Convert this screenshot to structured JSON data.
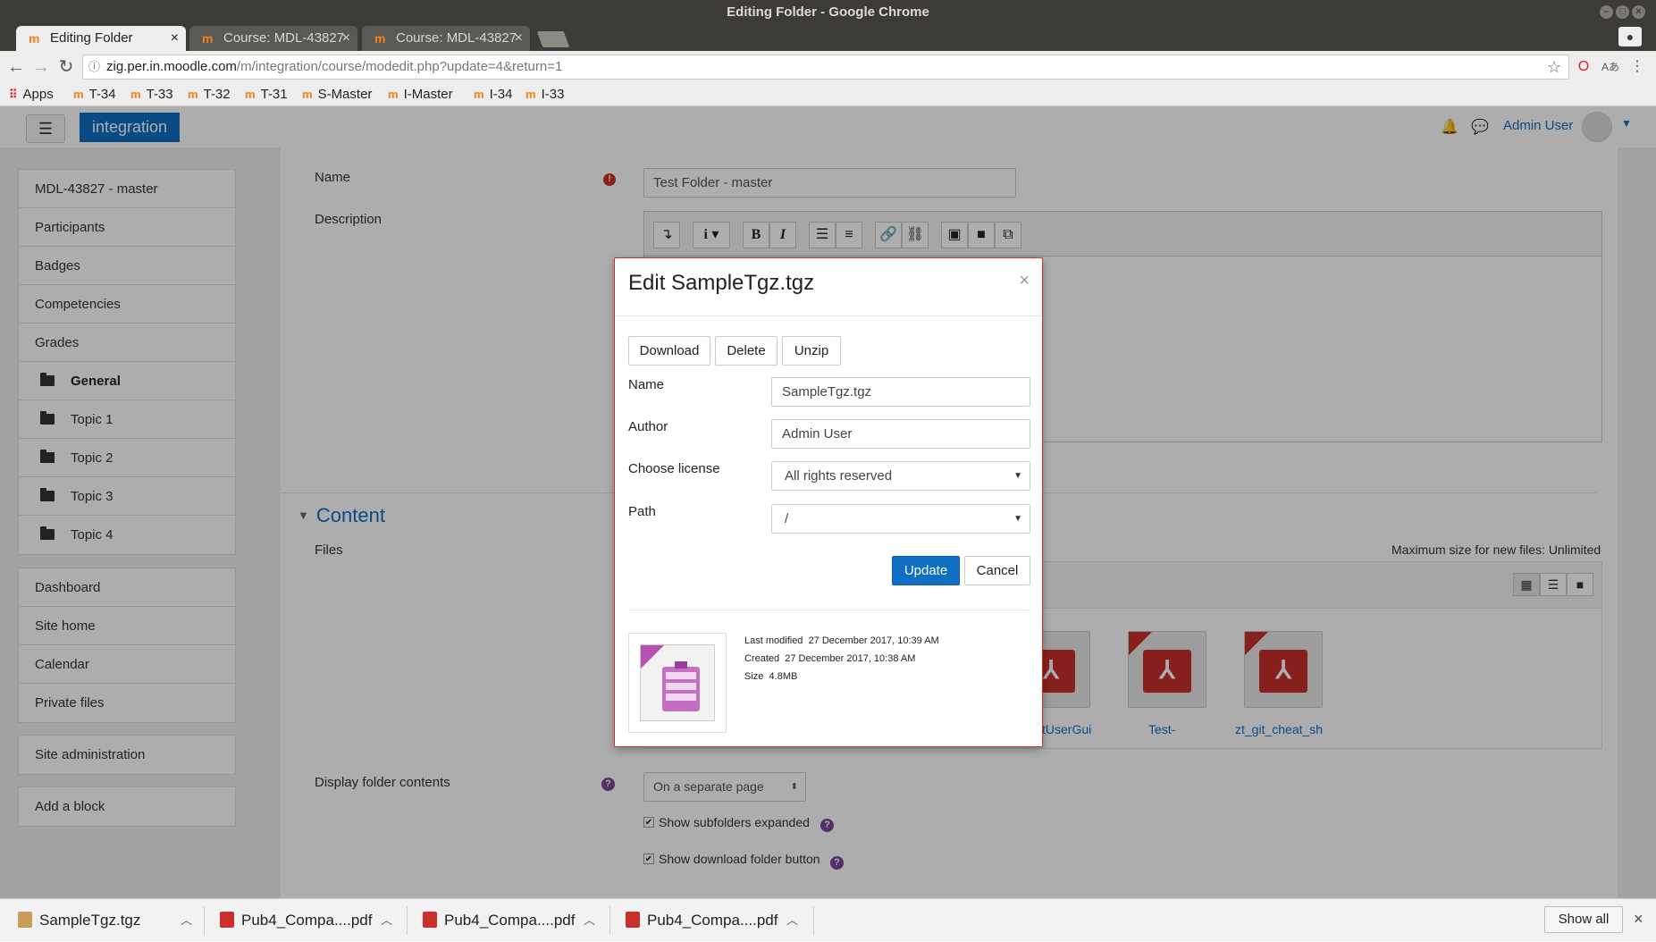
{
  "window": {
    "title": "Editing Folder - Google Chrome"
  },
  "tabs": [
    {
      "label": "Editing Folder",
      "active": true
    },
    {
      "label": "Course: MDL-43827",
      "active": false
    },
    {
      "label": "Course: MDL-43827",
      "active": false
    }
  ],
  "address": {
    "host": "zig.per.in.moodle.com",
    "path": "/m/integration/course/modedit.php?update=4&return=1"
  },
  "bookmarks": [
    "Apps",
    "T-34",
    "T-33",
    "T-32",
    "T-31",
    "S-Master",
    "I-Master",
    "I-34",
    "I-33"
  ],
  "navbar": {
    "brand": "integration",
    "user": "Admin User"
  },
  "leftnav": {
    "course": [
      "MDL-43827 - master",
      "Participants",
      "Badges",
      "Competencies",
      "Grades"
    ],
    "sections": [
      "General",
      "Topic 1",
      "Topic 2",
      "Topic 3",
      "Topic 4"
    ],
    "site": [
      "Dashboard",
      "Site home",
      "Calendar",
      "Private files"
    ],
    "admin": "Site administration",
    "addblock": "Add a block"
  },
  "form": {
    "name_label": "Name",
    "name_value": "Test Folder - master",
    "description_label": "Description",
    "content_header": "Content",
    "files_label": "Files",
    "max_size": "Maximum size for new files: Unlimited",
    "files": [
      "tUserGui",
      "Test-",
      "zt_git_cheat_sh"
    ],
    "display_label": "Display folder contents",
    "display_value": "On a separate page",
    "subfolders_label": "Show subfolders expanded",
    "download_label": "Show download folder button"
  },
  "modal": {
    "title": "Edit SampleTgz.tgz",
    "buttons": {
      "download": "Download",
      "delete": "Delete",
      "unzip": "Unzip",
      "update": "Update",
      "cancel": "Cancel"
    },
    "name_label": "Name",
    "name_value": "SampleTgz.tgz",
    "author_label": "Author",
    "author_value": "Admin User",
    "license_label": "Choose license",
    "license_value": "All rights reserved",
    "path_label": "Path",
    "path_value": "/",
    "last_modified_label": "Last modified",
    "last_modified_value": "27 December 2017, 10:39 AM",
    "created_label": "Created",
    "created_value": "27 December 2017, 10:38 AM",
    "size_label": "Size",
    "size_value": "4.8MB"
  },
  "downloads": [
    "SampleTgz.tgz",
    "Pub4_Compa....pdf",
    "Pub4_Compa....pdf",
    "Pub4_Compa....pdf"
  ],
  "shelf": {
    "show_all": "Show all"
  },
  "colors": {
    "brand": "#0f6fc5",
    "error": "#ca3120",
    "help": "#7c449b"
  }
}
